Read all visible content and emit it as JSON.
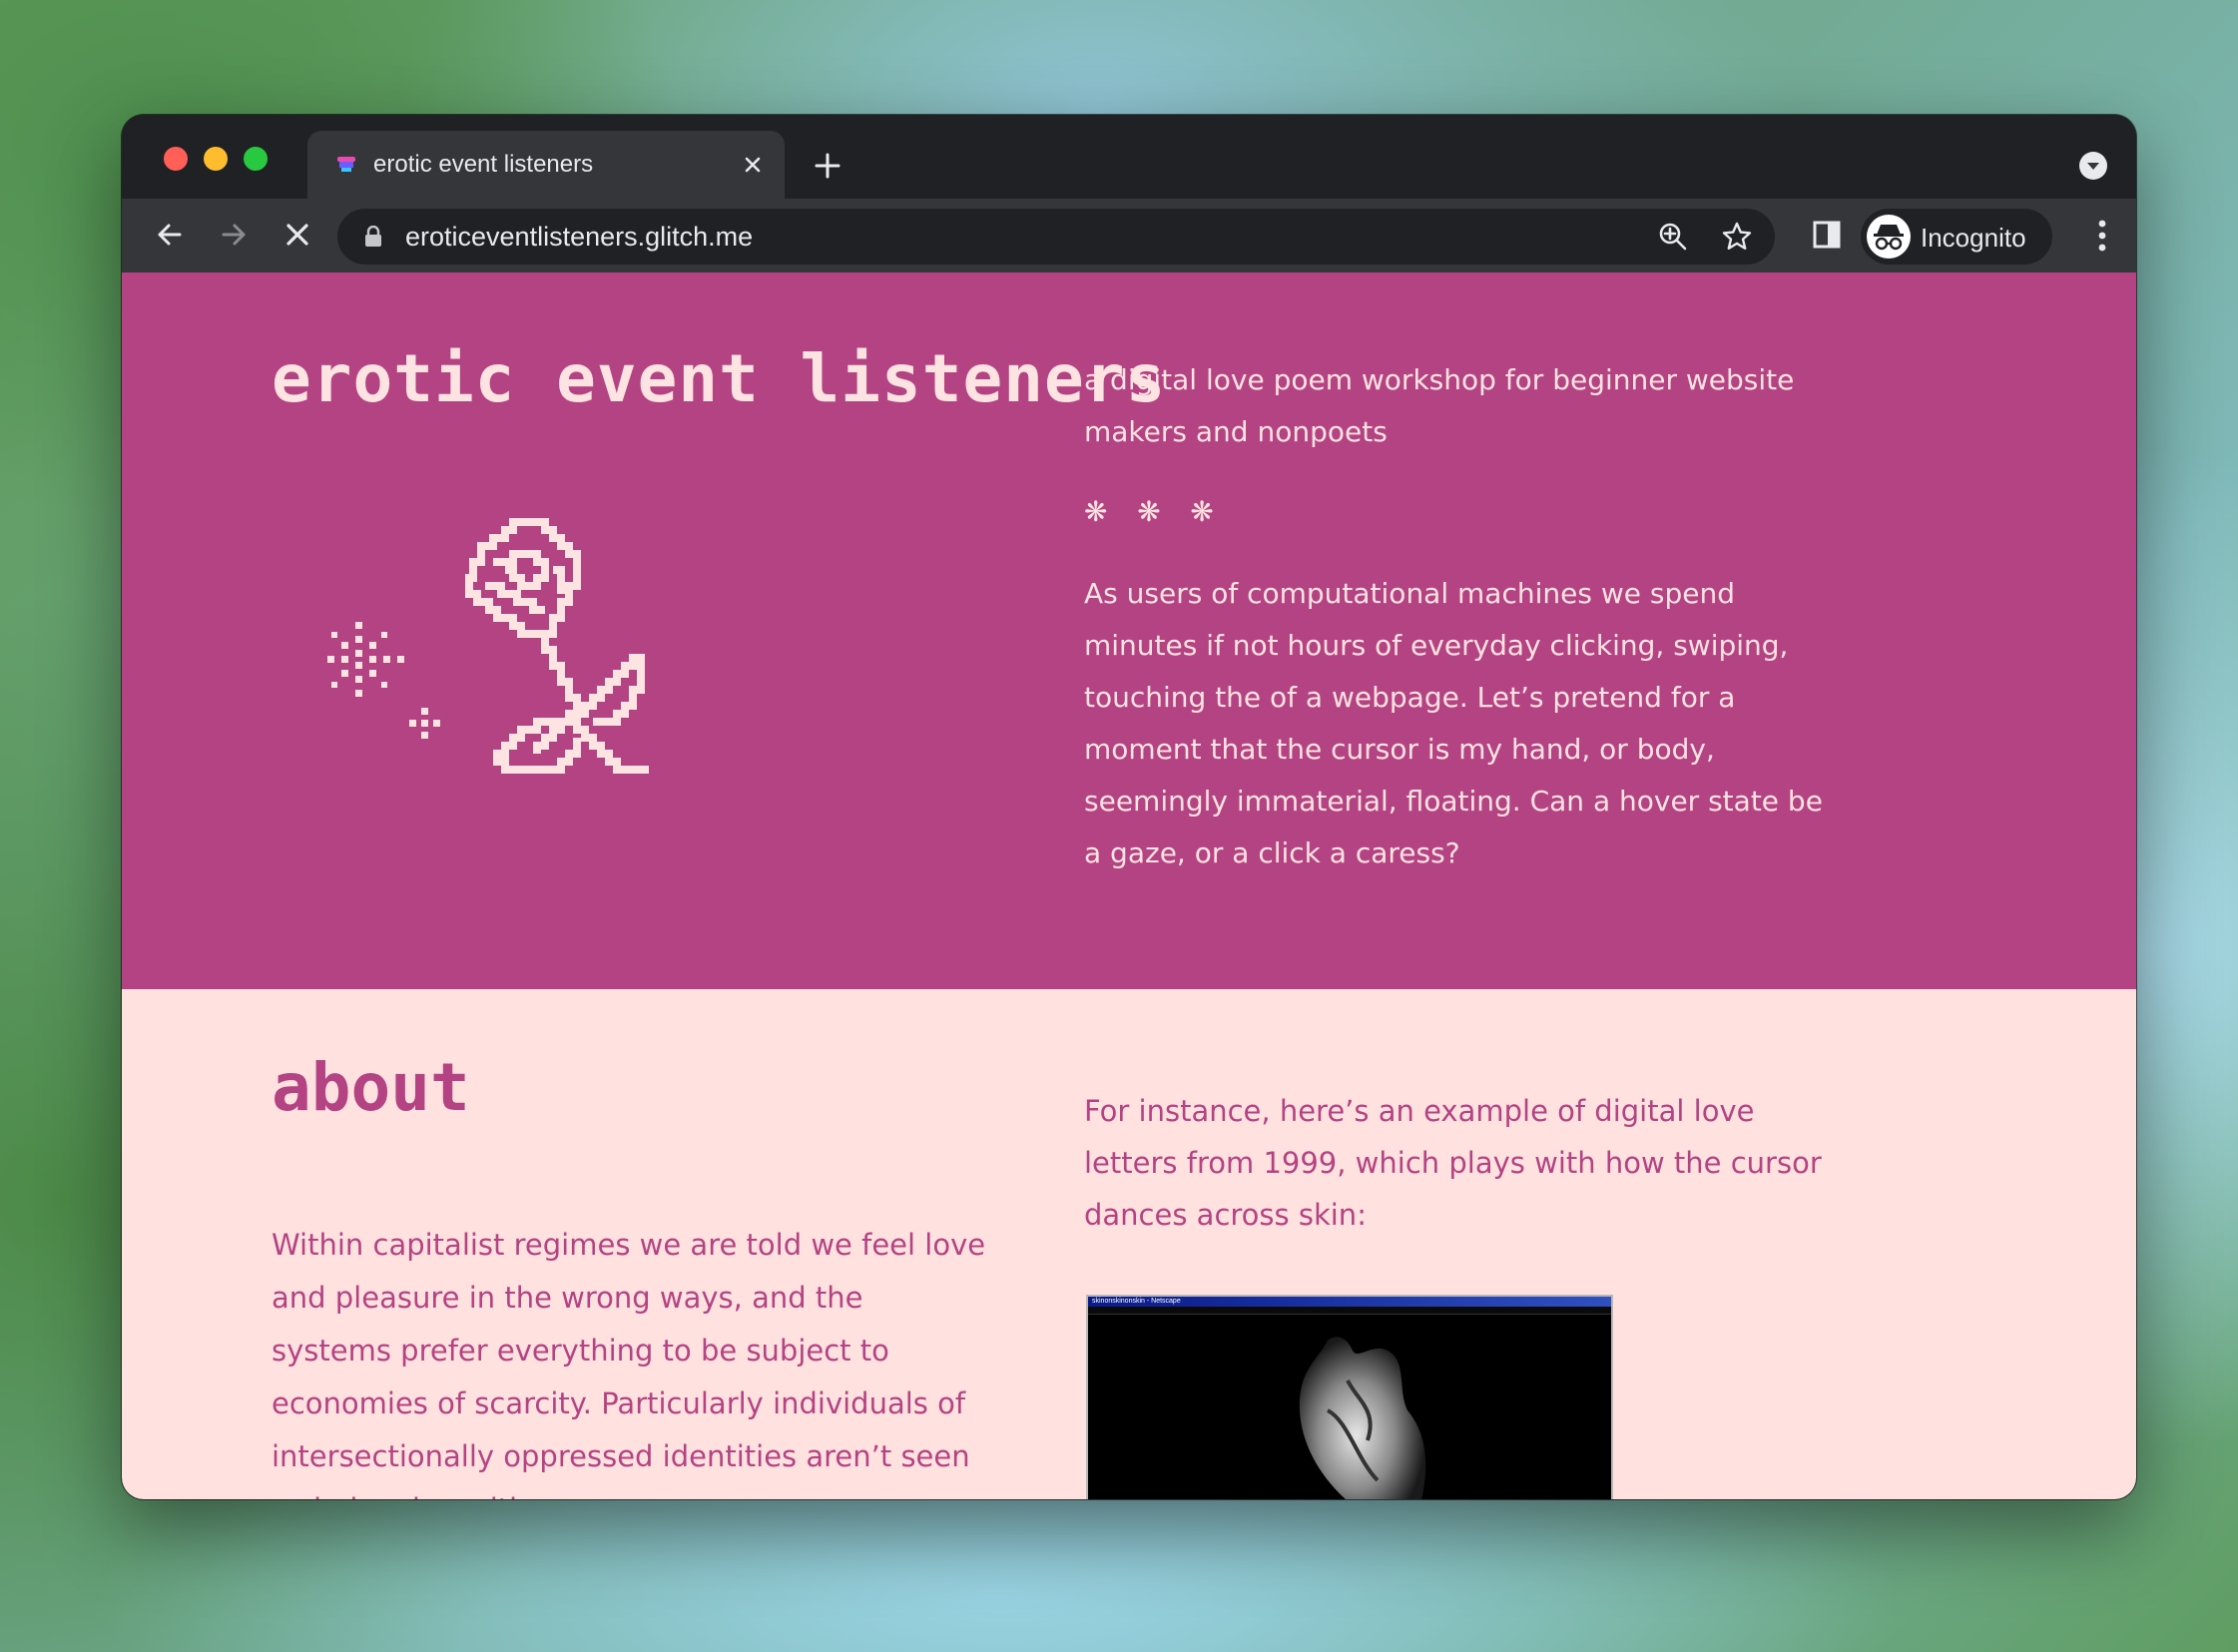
{
  "browser": {
    "tab_title": "erotic event listeners",
    "url": "eroticeventlisteners.glitch.me",
    "profile_label": "Incognito"
  },
  "colors": {
    "hero_bg": "#b44383",
    "hero_text": "#fde3e1",
    "about_bg": "#ffe2e0",
    "about_text": "#b44383"
  },
  "hero": {
    "title": "erotic event listeners",
    "tagline": "a digital love poem workshop for beginner website makers and nonpoets",
    "divider": "❋ ❋ ❋",
    "intro": "As users of computational machines we spend minutes if not hours of everyday clicking, swiping, touching the of a webpage. Let’s pretend for a moment that the cursor is my hand, or body, seemingly immaterial, floating. Can a hover state be a gaze, or a click a caress?"
  },
  "about": {
    "title": "about",
    "body": "Within capitalist regimes we are told we feel love and pleasure in the wrong ways, and the systems prefer everything to be subject to economies of scarcity. Particularly individuals of intersectionally oppressed identities aren’t seen as belonging with",
    "example_text": "For instance, here’s an example of digital love letters from 1999, which plays with how the cursor dances across skin:",
    "screenshot_window_title": "skinonskinonskin - Netscape"
  },
  "icons": [
    "close-icon",
    "plus-icon",
    "chevron-down-icon",
    "back-arrow-icon",
    "forward-arrow-icon",
    "stop-icon",
    "lock-icon",
    "zoom-icon",
    "star-icon",
    "side-panel-icon",
    "incognito-icon",
    "kebab-menu-icon",
    "rose-icon",
    "sparkle-icon"
  ]
}
